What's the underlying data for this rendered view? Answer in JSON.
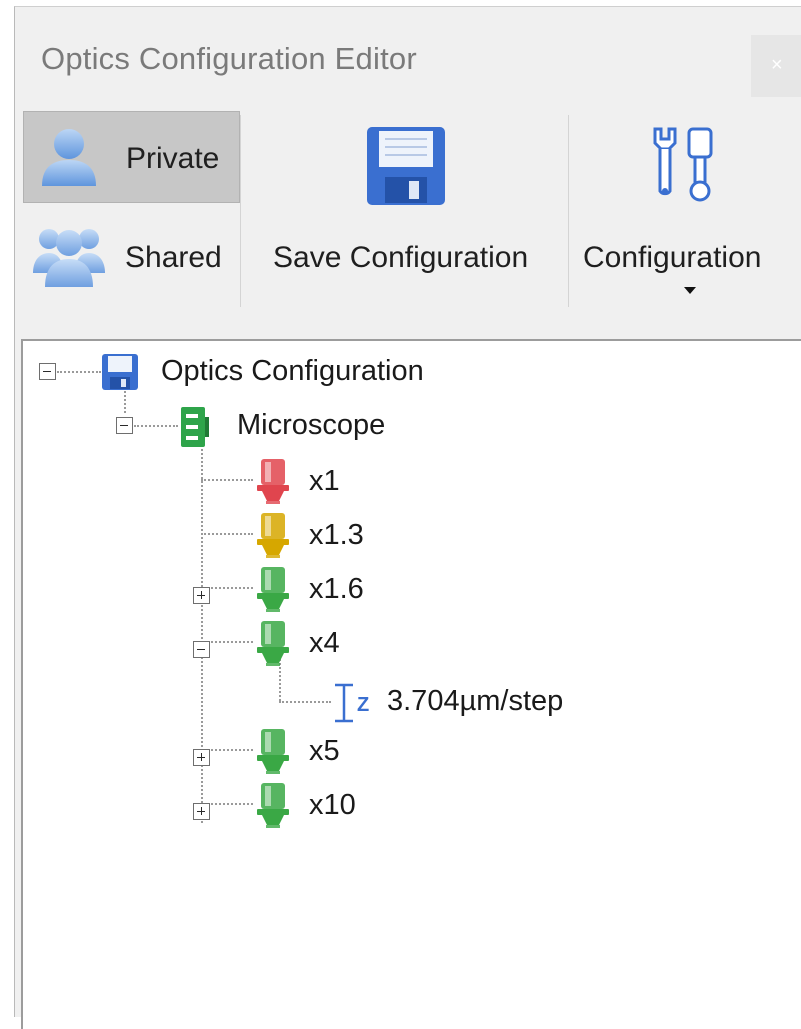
{
  "window": {
    "title": "Optics Configuration Editor",
    "close_glyph": "×"
  },
  "ribbon": {
    "private_label": "Private",
    "shared_label": "Shared",
    "save_label": "Save Configuration",
    "configuration_label": "Configuration",
    "icons": {
      "private": "user-icon",
      "shared": "users-group-icon",
      "save": "floppy-disk-icon",
      "configuration": "wrench-tools-icon",
      "dropdown": "dropdown-arrow-icon"
    }
  },
  "tree": {
    "root_label": "Optics Configuration",
    "microscope_label": "Microscope",
    "objectives": [
      {
        "label": "x1",
        "color": "#e0454e"
      },
      {
        "label": "x1.3",
        "color": "#d6a700"
      },
      {
        "label": "x1.6",
        "color": "#3aa845"
      },
      {
        "label": "x4",
        "color": "#3aa845"
      },
      {
        "label": "x5",
        "color": "#3aa845"
      },
      {
        "label": "x10",
        "color": "#3aa845"
      }
    ],
    "step_label": "3.704µm/step",
    "step_icon": "z-step-icon"
  },
  "colors": {
    "accent_blue": "#3a6fd0",
    "microscope_green": "#2ea44a"
  }
}
